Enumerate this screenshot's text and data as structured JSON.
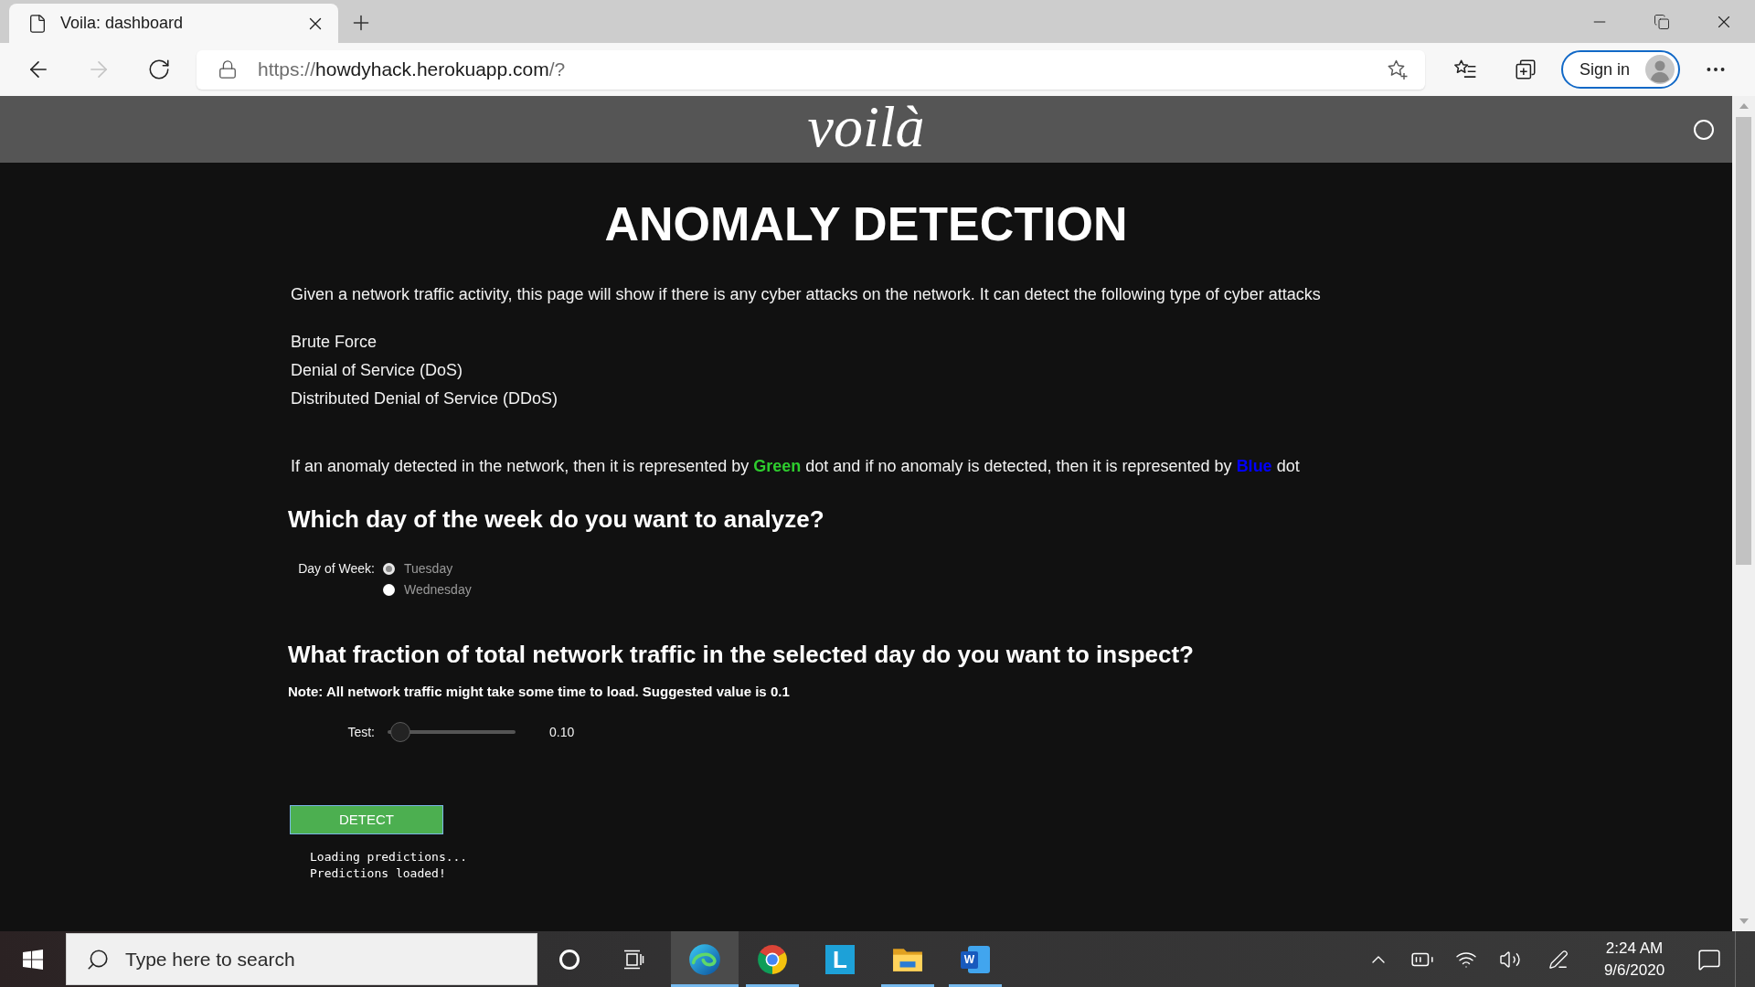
{
  "browser": {
    "tab": {
      "title": "Voila: dashboard",
      "selected": true
    },
    "forward_disabled": true,
    "url": {
      "scheme": "https://",
      "host": "howdyhack.herokuapp.com",
      "rest": "/?"
    },
    "sign_in": "Sign in"
  },
  "app_header": {
    "logo": "voilà"
  },
  "page": {
    "title": "ANOMALY DETECTION",
    "intro": "Given a network traffic activity, this page will show if there is any cyber attacks on the network. It can detect the following type of cyber attacks",
    "attacks": [
      "Brute Force",
      "Denial of Service (DoS)",
      "Distributed Denial of Service (DDoS)"
    ],
    "legend": [
      {
        "text": "If an anomaly detected in the network, then it is represented by "
      },
      {
        "text": "Green",
        "color": "#2ecc2e"
      },
      {
        "text": " dot and if no anomaly is detected, then it is represented by "
      },
      {
        "text": "Blue",
        "color": "#0000ff"
      },
      {
        "text": " dot"
      }
    ],
    "day_question": "Which day of the week do you want to analyze?",
    "day_picker": {
      "label": "Day of Week:",
      "options": [
        {
          "label": "Tuesday",
          "selected": true
        },
        {
          "label": "Wednesday",
          "selected": false
        }
      ]
    },
    "fraction_question": "What fraction of total network traffic in the selected day do you want to inspect?",
    "note": "Note: All network traffic might take some time to load. Suggested value is 0.1",
    "slider": {
      "label": "Test:",
      "level": 0.1,
      "reading": "0.10"
    },
    "detect_button": "DETECT",
    "output": [
      "Loading predictions...",
      "Predictions loaded!"
    ]
  },
  "taskbar": {
    "search": {
      "placeholder": "Type here to search"
    },
    "apps": [
      {
        "kind": "edge",
        "selected": true,
        "running": true
      },
      {
        "kind": "chrome",
        "selected": false,
        "running": true
      },
      {
        "kind": "letter",
        "glyph": "L",
        "selected": false,
        "running": false
      },
      {
        "kind": "folder",
        "selected": false,
        "running": true
      },
      {
        "kind": "word",
        "glyph": "W",
        "selected": false,
        "running": true
      }
    ],
    "time": "2:24 AM",
    "date": "9/6/2020"
  }
}
